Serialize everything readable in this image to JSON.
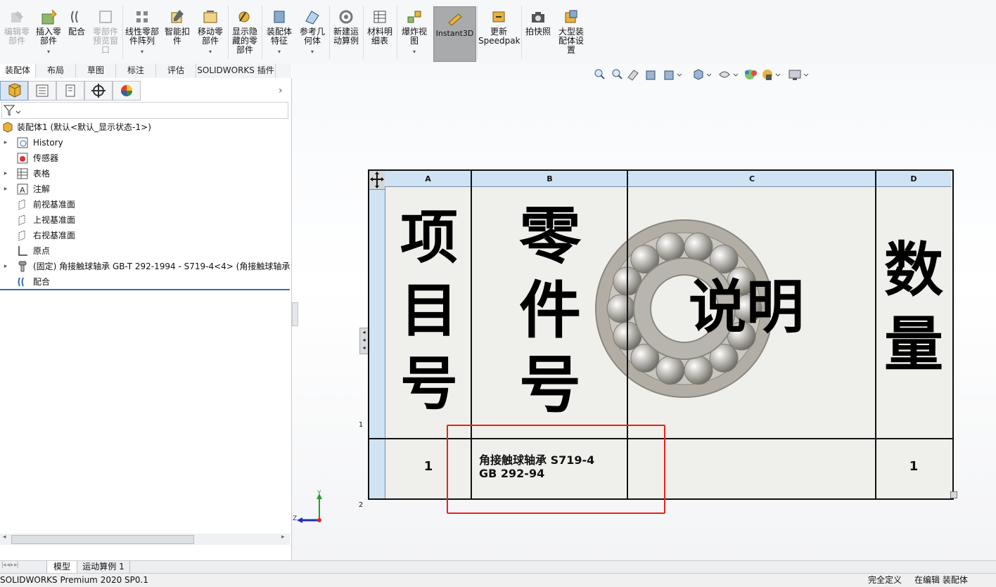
{
  "ribbon": {
    "buttons": [
      {
        "label": "编辑零\n部件",
        "disabled": true
      },
      {
        "label": "插入零\n部件",
        "disabled": false,
        "dropdown": true
      },
      {
        "label": "配合",
        "disabled": false
      },
      {
        "label": "零部件\n预览窗\n口",
        "disabled": true
      },
      {
        "label": "线性零部\n件阵列",
        "disabled": false,
        "dropdown": true
      },
      {
        "label": "智能扣\n件",
        "disabled": false
      },
      {
        "label": "移动零\n部件",
        "disabled": false,
        "dropdown": true
      },
      {
        "label": "显示隐\n藏的零\n部件",
        "disabled": false
      },
      {
        "label": "装配体\n特征",
        "disabled": false,
        "dropdown": true
      },
      {
        "label": "参考几\n何体",
        "disabled": false,
        "dropdown": true
      },
      {
        "label": "新建运\n动算例",
        "disabled": false
      },
      {
        "label": "材料明\n细表",
        "disabled": false
      },
      {
        "label": "爆炸视\n图",
        "disabled": false,
        "dropdown": true
      },
      {
        "label": "Instant3D",
        "disabled": false,
        "active": true
      },
      {
        "label": "更新\nSpeedpak",
        "disabled": false
      },
      {
        "label": "拍快照",
        "disabled": false
      },
      {
        "label": "大型装\n配体设\n置",
        "disabled": false
      }
    ]
  },
  "tabs": [
    "装配体",
    "布局",
    "草图",
    "标注",
    "评估",
    "SOLIDWORKS 插件"
  ],
  "tree": {
    "root": "装配体1  (默认<默认_显示状态-1>)",
    "items": [
      {
        "label": "History",
        "expandable": true,
        "icon": "history-icon"
      },
      {
        "label": "传感器",
        "expandable": false,
        "icon": "sensor-icon"
      },
      {
        "label": "表格",
        "expandable": true,
        "icon": "table-icon"
      },
      {
        "label": "注解",
        "expandable": true,
        "icon": "annotation-icon"
      },
      {
        "label": "前视基准面",
        "expandable": false,
        "icon": "plane-icon"
      },
      {
        "label": "上视基准面",
        "expandable": false,
        "icon": "plane-icon"
      },
      {
        "label": "右视基准面",
        "expandable": false,
        "icon": "plane-icon"
      },
      {
        "label": "原点",
        "expandable": false,
        "icon": "origin-icon"
      },
      {
        "label": "(固定) 角接触球轴承 GB-T 292-1994 - S719-4<4> (角接触球轴承",
        "expandable": true,
        "icon": "part-icon"
      },
      {
        "label": "配合",
        "expandable": false,
        "icon": "mates-icon"
      }
    ]
  },
  "bom": {
    "columns": [
      "A",
      "B",
      "C",
      "D"
    ],
    "row_numbers": [
      "1",
      "2"
    ],
    "header": {
      "item_no": "项目号",
      "part_no": "零件号",
      "description": "说明",
      "qty": "数量"
    },
    "rows": [
      {
        "item_no": "1",
        "part_line1": "角接触球轴承  S719-4",
        "part_line2": "GB 292-94",
        "description": "",
        "qty": "1"
      }
    ]
  },
  "triad": {
    "y": "Y",
    "z": "Z"
  },
  "bottom_tabs": [
    "模型",
    "运动算例 1"
  ],
  "status": {
    "app": "SOLIDWORKS Premium 2020 SP0.1",
    "definition": "完全定义",
    "editing": "在编辑 装配体"
  },
  "colors": {
    "highlight_box": "#e8231a",
    "header_blue": "#cfe3f5"
  }
}
